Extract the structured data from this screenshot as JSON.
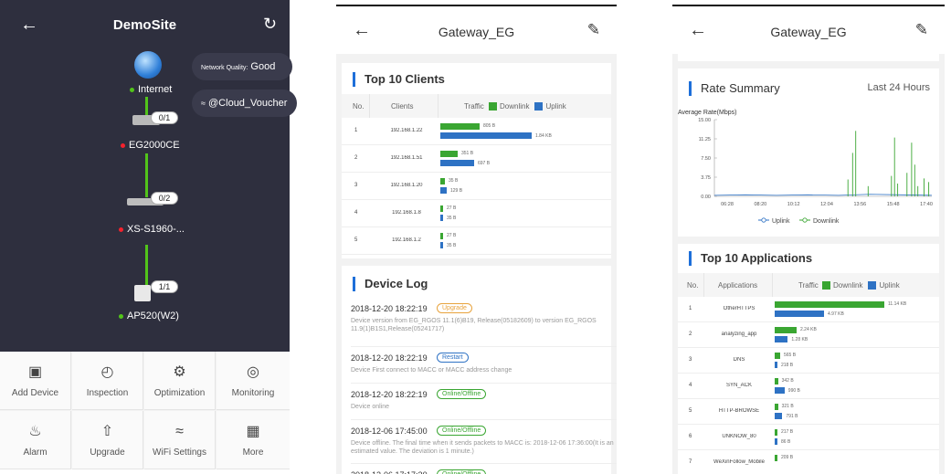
{
  "screen1": {
    "title": "DemoSite",
    "network_quality_label": "Network Quality:",
    "network_quality_value": "Good",
    "wifi_ssid": "@Cloud_Voucher",
    "nodes": [
      {
        "label": "Internet",
        "status": "online"
      },
      {
        "label": "EG2000CE",
        "status": "offline",
        "badge": "0/1"
      },
      {
        "label": "XS-S1960-...",
        "status": "offline",
        "badge": "0/2"
      },
      {
        "label": "AP520(W2)",
        "status": "online",
        "badge": "1/1"
      }
    ],
    "grid": [
      {
        "label": "Add Device",
        "icon": "add-device-icon"
      },
      {
        "label": "Inspection",
        "icon": "gauge-icon"
      },
      {
        "label": "Optimization",
        "icon": "gear-icon"
      },
      {
        "label": "Monitoring",
        "icon": "globe-icon"
      },
      {
        "label": "Alarm",
        "icon": "bell-icon"
      },
      {
        "label": "Upgrade",
        "icon": "upgrade-icon"
      },
      {
        "label": "WiFi Settings",
        "icon": "wifi-icon"
      },
      {
        "label": "More",
        "icon": "grid-icon"
      }
    ]
  },
  "screen2": {
    "title": "Gateway_EG",
    "top_clients": {
      "title": "Top 10 Clients",
      "col_no": "No.",
      "col_clients": "Clients",
      "col_traffic": "Traffic",
      "legend_down": "Downlink",
      "legend_up": "Uplink",
      "rows": [
        {
          "no": "1",
          "client": "192.168.1.22",
          "down": "805 B",
          "up": "1.84 KB",
          "down_frac": 0.43,
          "up_frac": 1.0
        },
        {
          "no": "2",
          "client": "192.168.1.51",
          "down": "351 B",
          "up": "697 B",
          "down_frac": 0.19,
          "up_frac": 0.37
        },
        {
          "no": "3",
          "client": "192.168.1.20",
          "down": "35 B",
          "up": "129 B",
          "down_frac": 0.05,
          "up_frac": 0.07
        },
        {
          "no": "4",
          "client": "192.168.1.8",
          "down": "27 B",
          "up": "35 B",
          "down_frac": 0.02,
          "up_frac": 0.02
        },
        {
          "no": "5",
          "client": "192.168.1.2",
          "down": "27 B",
          "up": "35 B",
          "down_frac": 0.02,
          "up_frac": 0.02
        }
      ]
    },
    "device_log": {
      "title": "Device Log",
      "entries": [
        {
          "time": "2018-12-20 18:22:19",
          "tag": "Upgrade",
          "tag_color": "#e8a33d",
          "text": "Device version from EG_RGOS 11.1(6)B19, Release(05182609) to version EG_RGOS 11.9(1)B1S1,Release(05241717)"
        },
        {
          "time": "2018-12-20 18:22:19",
          "tag": "Restart",
          "tag_color": "#2e72c4",
          "text": "Device First connect to MACC or MACC address change"
        },
        {
          "time": "2018-12-20 18:22:19",
          "tag": "Online/Offline",
          "tag_color": "#3aa632",
          "text": "Device online"
        },
        {
          "time": "2018-12-06 17:45:00",
          "tag": "Online/Offline",
          "tag_color": "#3aa632",
          "text": "Device offline. The final time when it sends packets to MACC is: 2018-12-06 17:36:00(It is an estimated value. The deviation is 1 minute.)"
        },
        {
          "time": "2018-12-06 17:17:30",
          "tag": "Online/Offline",
          "tag_color": "#3aa632",
          "text": ""
        }
      ]
    }
  },
  "screen3": {
    "title": "Gateway_EG",
    "rate_summary": {
      "title": "Rate Summary",
      "period": "Last 24 Hours"
    },
    "chart_data": {
      "type": "line",
      "ylabel": "Average Rate(Mbps)",
      "y_ticks": [
        "15.00",
        "11.25",
        "7.50",
        "3.75",
        "0.00"
      ],
      "ylim": [
        0,
        15
      ],
      "x_ticks": [
        "06:28",
        "08:20",
        "10:12",
        "12:04",
        "13:56",
        "15:48",
        "17:40"
      ],
      "legend": [
        "Uplink",
        "Downlink"
      ],
      "series": [
        {
          "name": "Uplink",
          "color": "#2e72c4",
          "points": [
            [
              0,
              0.2
            ],
            [
              40,
              0.3
            ],
            [
              80,
              0.2
            ],
            [
              120,
              0.3
            ],
            [
              160,
              0.2
            ],
            [
              200,
              0.4
            ],
            [
              240,
              0.3
            ],
            [
              280,
              0.2
            ]
          ]
        },
        {
          "name": "Downlink",
          "color": "#3aa632",
          "spikes": [
            [
              172,
              3.3
            ],
            [
              178,
              8.5
            ],
            [
              182,
              12.8
            ],
            [
              198,
              2.0
            ],
            [
              228,
              4.0
            ],
            [
              232,
              11.5
            ],
            [
              236,
              2.5
            ],
            [
              248,
              4.6
            ],
            [
              254,
              10.5
            ],
            [
              258,
              6.2
            ],
            [
              262,
              2.0
            ],
            [
              270,
              3.5
            ],
            [
              276,
              2.8
            ]
          ]
        }
      ]
    },
    "top_apps": {
      "title": "Top 10 Applications",
      "col_no": "No.",
      "col_apps": "Applications",
      "col_traffic": "Traffic",
      "legend_down": "Downlink",
      "legend_up": "Uplink",
      "rows": [
        {
          "no": "1",
          "app": "OtherHTTPS",
          "down": "11.14 KB",
          "up": "4.97 KB",
          "down_frac": 1.0,
          "up_frac": 0.45
        },
        {
          "no": "2",
          "app": "analyzing_app",
          "down": "2.24 KB",
          "up": "1.28 KB",
          "down_frac": 0.2,
          "up_frac": 0.12
        },
        {
          "no": "3",
          "app": "DNS",
          "down": "565 B",
          "up": "218 B",
          "down_frac": 0.05,
          "up_frac": 0.02
        },
        {
          "no": "4",
          "app": "SYN_ACK",
          "down": "342 B",
          "up": "990 B",
          "down_frac": 0.03,
          "up_frac": 0.09
        },
        {
          "no": "5",
          "app": "HTTP-BROWSE",
          "down": "321 B",
          "up": "791 B",
          "down_frac": 0.03,
          "up_frac": 0.07
        },
        {
          "no": "6",
          "app": "UNKNOW_80",
          "down": "217 B",
          "up": "86 B",
          "down_frac": 0.02,
          "up_frac": 0.01
        },
        {
          "no": "7",
          "app": "WeXinFollow_Mobile",
          "down": "209 B",
          "up": "",
          "down_frac": 0.02,
          "up_frac": 0
        }
      ]
    }
  }
}
